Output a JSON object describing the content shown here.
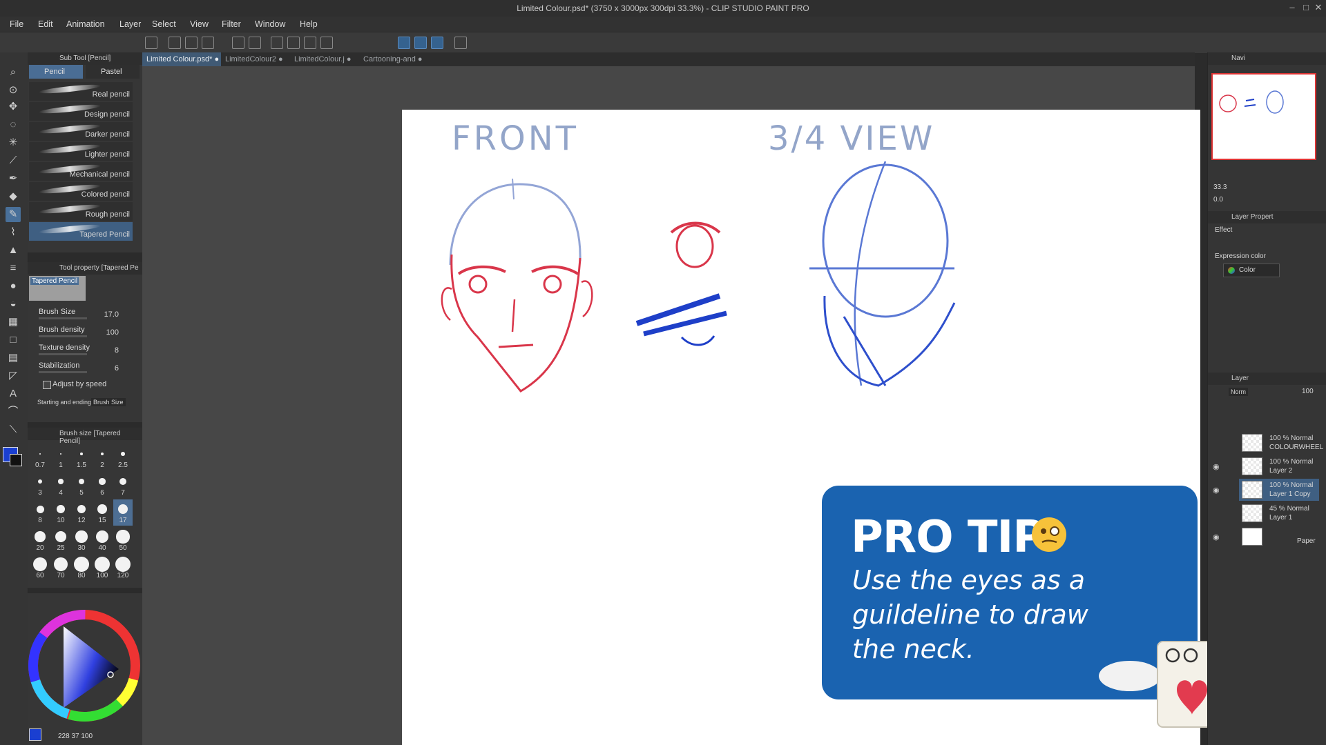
{
  "window": {
    "title": "Limited Colour.psd* (3750 x 3000px 300dpi 33.3%)  - CLIP STUDIO PAINT PRO"
  },
  "menu": [
    "File",
    "Edit",
    "Animation",
    "Layer",
    "Select",
    "View",
    "Filter",
    "Window",
    "Help"
  ],
  "doc_tabs": [
    {
      "label": "Limited Colour.psd*",
      "active": true
    },
    {
      "label": "LimitedColour2",
      "active": false
    },
    {
      "label": "LimitedColour.j",
      "active": false
    },
    {
      "label": "Cartooning-and",
      "active": false
    }
  ],
  "sub_tool": {
    "header": "Sub Tool [Pencil]",
    "tabs": [
      "Pencil",
      "Pastel"
    ],
    "brushes": [
      "Real pencil",
      "Design pencil",
      "Darker pencil",
      "Lighter pencil",
      "Mechanical pencil",
      "Colored pencil",
      "Rough pencil",
      "Tapered Pencil"
    ],
    "selected_index": 7
  },
  "tool_property": {
    "header": "Tool property [Tapered Pe",
    "preset_name": "Tapered Pencil",
    "rows": [
      {
        "label": "Brush Size",
        "value": "17.0"
      },
      {
        "label": "Brush density",
        "value": "100"
      },
      {
        "label": "Texture density",
        "value": "8"
      },
      {
        "label": "Stabilization",
        "value": "6"
      }
    ],
    "adjust_by_speed": "Adjust by speed",
    "starting_ending": "Starting and ending",
    "starting_ending_value": "Brush Size"
  },
  "brush_size": {
    "header": "Brush size [Tapered Pencil]",
    "sizes": [
      "0.7",
      "1",
      "1.5",
      "2",
      "2.5",
      "3",
      "4",
      "5",
      "6",
      "7",
      "8",
      "10",
      "12",
      "15",
      "17",
      "20",
      "25",
      "30",
      "40",
      "50",
      "60",
      "70",
      "80",
      "100",
      "120"
    ],
    "selected": "17"
  },
  "color_panel": {
    "readout": "228  37  100",
    "main_color": "#1a3fd1",
    "sub_color": "#111111"
  },
  "canvas": {
    "label_front": "FRONT",
    "label_three_quarter": "3/4 VIEW"
  },
  "pro_tip": {
    "title": "PRO TIP",
    "body": "Use the eyes as a guildeline to draw the neck."
  },
  "navigator": {
    "header": "Navi",
    "zoom": "33.3",
    "rotation": "0.0"
  },
  "layer_property": {
    "header": "Layer Propert",
    "effect": "Effect",
    "expression_color": "Expression color",
    "color_option": "Color"
  },
  "layer_panel": {
    "header": "Layer",
    "blend_mode": "Norm",
    "opacity": "100",
    "layers": [
      {
        "line1": "100 % Normal",
        "line2": "COLOURWHEEL",
        "visible": false,
        "selected": false
      },
      {
        "line1": "100 % Normal",
        "line2": "Layer 2",
        "visible": true,
        "selected": false
      },
      {
        "line1": "100 % Normal",
        "line2": "Layer 1 Copy",
        "visible": true,
        "selected": true
      },
      {
        "line1": "45 % Normal",
        "line2": "Layer 1",
        "visible": false,
        "selected": false
      },
      {
        "line1": "",
        "line2": "Paper",
        "visible": true,
        "selected": false
      }
    ]
  }
}
